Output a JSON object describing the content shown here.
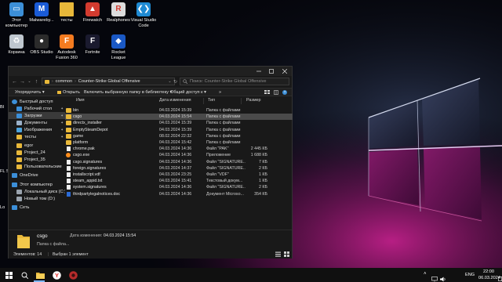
{
  "colors": {
    "folder": "#e8b83a",
    "window_bg": "#191919",
    "selection": "#4a4a4a",
    "taskbar": "#101010",
    "wallpaper_accent": "#b11a7a"
  },
  "desktop_icons": [
    {
      "id": "this-pc",
      "label": "Этот компьютер",
      "icon": "computer-icon",
      "color": "#3c8fd8"
    },
    {
      "id": "malwarebytes",
      "label": "Malwareby...",
      "icon": "malwarebytes-icon",
      "color": "#1a5bd6"
    },
    {
      "id": "tests",
      "label": "тесты",
      "icon": "folder-icon",
      "color": "#e8b83a"
    },
    {
      "id": "firewatch",
      "label": "Firewatch",
      "icon": "firewatch-icon",
      "color": "#d33b2f"
    },
    {
      "id": "realphones",
      "label": "Realphones",
      "icon": "realphones-icon",
      "color": "#dcdcdc"
    },
    {
      "id": "vscode",
      "label": "Visual Studio Code",
      "icon": "vscode-icon",
      "color": "#1f8ad2"
    },
    {
      "id": "recycle-bin",
      "label": "Корзина",
      "icon": "recycle-bin-icon",
      "color": "#bfc7cf"
    },
    {
      "id": "obs",
      "label": "OBS Studio",
      "icon": "obs-icon",
      "color": "#2b2b2b"
    },
    {
      "id": "fusion",
      "label": "Autodesk Fusion 360",
      "icon": "fusion-icon",
      "color": "#f47b20"
    },
    {
      "id": "fortnite",
      "label": "Fortnite",
      "icon": "fortnite-icon",
      "color": "#1a1a2e"
    },
    {
      "id": "rocket-league",
      "label": "Rocket League",
      "icon": "rocket-league-icon",
      "color": "#1a58c4"
    }
  ],
  "left_edge_labels": [
    "Bl",
    "FL S",
    "Lo"
  ],
  "explorer": {
    "address": {
      "root": "common",
      "current": "Counter-Strike Global Offensive"
    },
    "search_placeholder": "Поиск: Counter-Strike Global Offensive",
    "commands": {
      "organize": "Упорядочить ▾",
      "open": "Открыть",
      "include_library": "Включить выбранную папку в библиотеку ▾",
      "share": "Общий доступ к ▾",
      "more": "»"
    },
    "nav_items": [
      {
        "label": "Быстрый доступ",
        "icon": "star-icon",
        "pinned": false,
        "selected": false
      },
      {
        "label": "Рабочий стол",
        "icon": "desktop-icon",
        "pinned": true,
        "selected": false
      },
      {
        "label": "Загрузки",
        "icon": "download-icon",
        "pinned": true,
        "selected": true
      },
      {
        "label": "Документы",
        "icon": "documents-icon",
        "pinned": true,
        "selected": false
      },
      {
        "label": "Изображения",
        "icon": "pictures-icon",
        "pinned": true,
        "selected": false
      },
      {
        "label": "тесты",
        "icon": "folder-icon",
        "pinned": true,
        "selected": false
      },
      {
        "label": "egor",
        "icon": "folder-icon",
        "pinned": false,
        "selected": false
      },
      {
        "label": "Project_24",
        "icon": "folder-icon",
        "pinned": false,
        "selected": false
      },
      {
        "label": "Project_35",
        "icon": "folder-icon",
        "pinned": false,
        "selected": false
      },
      {
        "label": "Пользовательские",
        "icon": "folder-icon",
        "pinned": false,
        "selected": false
      },
      {
        "label": "OneDrive",
        "icon": "onedrive-icon",
        "pinned": false,
        "selected": false
      },
      {
        "label": "Этот компьютер",
        "icon": "computer-icon",
        "pinned": false,
        "selected": false
      },
      {
        "label": "Локальный диск (C:)",
        "icon": "drive-icon",
        "pinned": false,
        "selected": false
      },
      {
        "label": "Новый том (D:)",
        "icon": "drive-icon",
        "pinned": false,
        "selected": false
      },
      {
        "label": "Сеть",
        "icon": "network-icon",
        "pinned": false,
        "selected": false
      }
    ],
    "columns": {
      "name": "Имя",
      "date": "Дата изменения",
      "type": "Тип",
      "size": "Размер"
    },
    "files": [
      {
        "name": "bin",
        "date": "04.03.2024 15:39",
        "type": "Папка с файлами",
        "size": "",
        "kind": "folder",
        "selected": false
      },
      {
        "name": "csgo",
        "date": "04.03.2024 15:54",
        "type": "Папка с файлами",
        "size": "",
        "kind": "folder",
        "selected": true
      },
      {
        "name": "directx_installer",
        "date": "04.03.2024 15:39",
        "type": "Папка с файлами",
        "size": "",
        "kind": "folder",
        "selected": false
      },
      {
        "name": "EmptySteamDepot",
        "date": "04.03.2024 15:39",
        "type": "Папка с файлами",
        "size": "",
        "kind": "folder",
        "selected": false
      },
      {
        "name": "game",
        "date": "08.02.2024 22:32",
        "type": "Папка с файлами",
        "size": "",
        "kind": "folder",
        "selected": false
      },
      {
        "name": "platform",
        "date": "04.03.2024 15:42",
        "type": "Папка с файлами",
        "size": "",
        "kind": "folder",
        "selected": false
      },
      {
        "name": "chrome.pak",
        "date": "04.03.2024 14:36",
        "type": "Файл \"PAK\"",
        "size": "2 445 КБ",
        "kind": "file",
        "selected": false
      },
      {
        "name": "csgo.exe",
        "date": "04.03.2024 14:36",
        "type": "Приложение",
        "size": "1 688 КБ",
        "kind": "exe",
        "selected": false
      },
      {
        "name": "csgo.signatures",
        "date": "04.03.2024 14:36",
        "type": "Файл \"SIGNATURE...",
        "size": "7 КБ",
        "kind": "file",
        "selected": false
      },
      {
        "name": "foreign.signatures",
        "date": "04.03.2024 14:37",
        "type": "Файл \"SIGNATURE...",
        "size": "2 КБ",
        "kind": "file",
        "selected": false
      },
      {
        "name": "installscript.vdf",
        "date": "04.03.2024 23:25",
        "type": "Файл \"VDF\"",
        "size": "1 КБ",
        "kind": "file",
        "selected": false
      },
      {
        "name": "steam_appid.txt",
        "date": "04.03.2024 15:41",
        "type": "Текстовый докум...",
        "size": "1 КБ",
        "kind": "file",
        "selected": false
      },
      {
        "name": "system.signatures",
        "date": "04.03.2024 14:36",
        "type": "Файл \"SIGNATURE...",
        "size": "2 КБ",
        "kind": "file",
        "selected": false
      },
      {
        "name": "thirdpartylegalnotices.doc",
        "date": "04.03.2024 14:36",
        "type": "Документ Microso...",
        "size": "354 КБ",
        "kind": "doc",
        "selected": false
      }
    ],
    "details": {
      "name": "csgo",
      "date_label": "Дата изменения:",
      "date_value": "04.03.2024 15:54",
      "type": "Папка с файла..."
    },
    "status": {
      "count": "Элементов: 14",
      "selection": "Выбран 1 элемент"
    }
  },
  "taskbar": {
    "time": "22:00",
    "date": "06.03.2024",
    "lang": "ENG"
  }
}
